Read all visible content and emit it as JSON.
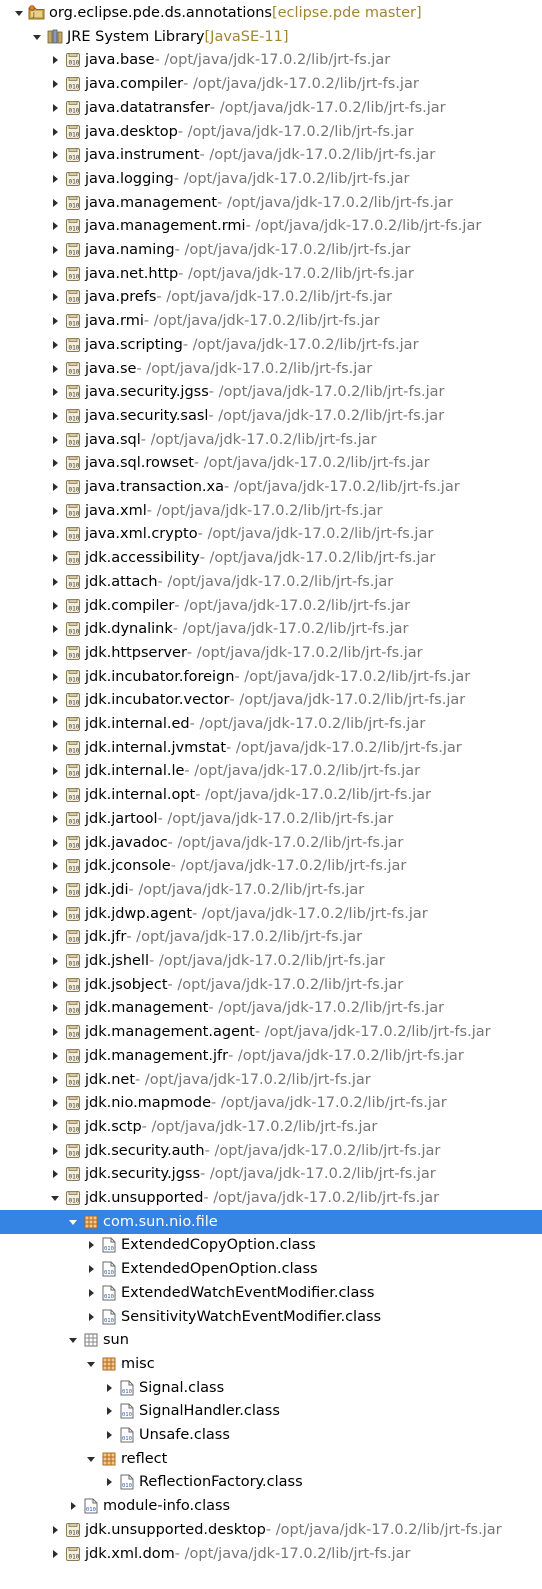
{
  "colors": {
    "selection": "#3584e4",
    "decoration": "#777777",
    "vcs_decoration": "#a08630",
    "jar_icon": "#8a7a55",
    "package_icon": "#b3651e",
    "class_icon": "#2c5b9e"
  },
  "tree": [
    {
      "label": "org.eclipse.pde.ds.annotations",
      "decoration": " [eclipse.pde master]",
      "level": 0,
      "icon": "project-icon",
      "state": "expanded"
    },
    {
      "label": "JRE System Library",
      "decoration": " [JavaSE-11]",
      "level": 1,
      "icon": "library-icon",
      "state": "expanded"
    },
    {
      "label": "java.base",
      "decoration": " - /opt/java/jdk-17.0.2/lib/jrt-fs.jar",
      "level": 2,
      "icon": "jar-icon",
      "state": "collapsed"
    },
    {
      "label": "java.compiler",
      "decoration": " - /opt/java/jdk-17.0.2/lib/jrt-fs.jar",
      "level": 2,
      "icon": "jar-icon",
      "state": "collapsed"
    },
    {
      "label": "java.datatransfer",
      "decoration": " - /opt/java/jdk-17.0.2/lib/jrt-fs.jar",
      "level": 2,
      "icon": "jar-icon",
      "state": "collapsed"
    },
    {
      "label": "java.desktop",
      "decoration": " - /opt/java/jdk-17.0.2/lib/jrt-fs.jar",
      "level": 2,
      "icon": "jar-icon",
      "state": "collapsed"
    },
    {
      "label": "java.instrument",
      "decoration": " - /opt/java/jdk-17.0.2/lib/jrt-fs.jar",
      "level": 2,
      "icon": "jar-icon",
      "state": "collapsed"
    },
    {
      "label": "java.logging",
      "decoration": " - /opt/java/jdk-17.0.2/lib/jrt-fs.jar",
      "level": 2,
      "icon": "jar-icon",
      "state": "collapsed"
    },
    {
      "label": "java.management",
      "decoration": " - /opt/java/jdk-17.0.2/lib/jrt-fs.jar",
      "level": 2,
      "icon": "jar-icon",
      "state": "collapsed"
    },
    {
      "label": "java.management.rmi",
      "decoration": " - /opt/java/jdk-17.0.2/lib/jrt-fs.jar",
      "level": 2,
      "icon": "jar-icon",
      "state": "collapsed"
    },
    {
      "label": "java.naming",
      "decoration": " - /opt/java/jdk-17.0.2/lib/jrt-fs.jar",
      "level": 2,
      "icon": "jar-icon",
      "state": "collapsed"
    },
    {
      "label": "java.net.http",
      "decoration": " - /opt/java/jdk-17.0.2/lib/jrt-fs.jar",
      "level": 2,
      "icon": "jar-icon",
      "state": "collapsed"
    },
    {
      "label": "java.prefs",
      "decoration": " - /opt/java/jdk-17.0.2/lib/jrt-fs.jar",
      "level": 2,
      "icon": "jar-icon",
      "state": "collapsed"
    },
    {
      "label": "java.rmi",
      "decoration": " - /opt/java/jdk-17.0.2/lib/jrt-fs.jar",
      "level": 2,
      "icon": "jar-icon",
      "state": "collapsed"
    },
    {
      "label": "java.scripting",
      "decoration": " - /opt/java/jdk-17.0.2/lib/jrt-fs.jar",
      "level": 2,
      "icon": "jar-icon",
      "state": "collapsed"
    },
    {
      "label": "java.se",
      "decoration": " - /opt/java/jdk-17.0.2/lib/jrt-fs.jar",
      "level": 2,
      "icon": "jar-icon",
      "state": "collapsed"
    },
    {
      "label": "java.security.jgss",
      "decoration": " - /opt/java/jdk-17.0.2/lib/jrt-fs.jar",
      "level": 2,
      "icon": "jar-icon",
      "state": "collapsed"
    },
    {
      "label": "java.security.sasl",
      "decoration": " - /opt/java/jdk-17.0.2/lib/jrt-fs.jar",
      "level": 2,
      "icon": "jar-icon",
      "state": "collapsed"
    },
    {
      "label": "java.sql",
      "decoration": " - /opt/java/jdk-17.0.2/lib/jrt-fs.jar",
      "level": 2,
      "icon": "jar-icon",
      "state": "collapsed"
    },
    {
      "label": "java.sql.rowset",
      "decoration": " - /opt/java/jdk-17.0.2/lib/jrt-fs.jar",
      "level": 2,
      "icon": "jar-icon",
      "state": "collapsed"
    },
    {
      "label": "java.transaction.xa",
      "decoration": " - /opt/java/jdk-17.0.2/lib/jrt-fs.jar",
      "level": 2,
      "icon": "jar-icon",
      "state": "collapsed"
    },
    {
      "label": "java.xml",
      "decoration": " - /opt/java/jdk-17.0.2/lib/jrt-fs.jar",
      "level": 2,
      "icon": "jar-icon",
      "state": "collapsed"
    },
    {
      "label": "java.xml.crypto",
      "decoration": " - /opt/java/jdk-17.0.2/lib/jrt-fs.jar",
      "level": 2,
      "icon": "jar-icon",
      "state": "collapsed"
    },
    {
      "label": "jdk.accessibility",
      "decoration": " - /opt/java/jdk-17.0.2/lib/jrt-fs.jar",
      "level": 2,
      "icon": "jar-icon",
      "state": "collapsed"
    },
    {
      "label": "jdk.attach",
      "decoration": " - /opt/java/jdk-17.0.2/lib/jrt-fs.jar",
      "level": 2,
      "icon": "jar-icon",
      "state": "collapsed"
    },
    {
      "label": "jdk.compiler",
      "decoration": " - /opt/java/jdk-17.0.2/lib/jrt-fs.jar",
      "level": 2,
      "icon": "jar-icon",
      "state": "collapsed"
    },
    {
      "label": "jdk.dynalink",
      "decoration": " - /opt/java/jdk-17.0.2/lib/jrt-fs.jar",
      "level": 2,
      "icon": "jar-icon",
      "state": "collapsed"
    },
    {
      "label": "jdk.httpserver",
      "decoration": " - /opt/java/jdk-17.0.2/lib/jrt-fs.jar",
      "level": 2,
      "icon": "jar-icon",
      "state": "collapsed"
    },
    {
      "label": "jdk.incubator.foreign",
      "decoration": " - /opt/java/jdk-17.0.2/lib/jrt-fs.jar",
      "level": 2,
      "icon": "jar-icon",
      "state": "collapsed"
    },
    {
      "label": "jdk.incubator.vector",
      "decoration": " - /opt/java/jdk-17.0.2/lib/jrt-fs.jar",
      "level": 2,
      "icon": "jar-icon",
      "state": "collapsed"
    },
    {
      "label": "jdk.internal.ed",
      "decoration": " - /opt/java/jdk-17.0.2/lib/jrt-fs.jar",
      "level": 2,
      "icon": "jar-icon",
      "state": "collapsed"
    },
    {
      "label": "jdk.internal.jvmstat",
      "decoration": " - /opt/java/jdk-17.0.2/lib/jrt-fs.jar",
      "level": 2,
      "icon": "jar-icon",
      "state": "collapsed"
    },
    {
      "label": "jdk.internal.le",
      "decoration": " - /opt/java/jdk-17.0.2/lib/jrt-fs.jar",
      "level": 2,
      "icon": "jar-icon",
      "state": "collapsed"
    },
    {
      "label": "jdk.internal.opt",
      "decoration": " - /opt/java/jdk-17.0.2/lib/jrt-fs.jar",
      "level": 2,
      "icon": "jar-icon",
      "state": "collapsed"
    },
    {
      "label": "jdk.jartool",
      "decoration": " - /opt/java/jdk-17.0.2/lib/jrt-fs.jar",
      "level": 2,
      "icon": "jar-icon",
      "state": "collapsed"
    },
    {
      "label": "jdk.javadoc",
      "decoration": " - /opt/java/jdk-17.0.2/lib/jrt-fs.jar",
      "level": 2,
      "icon": "jar-icon",
      "state": "collapsed"
    },
    {
      "label": "jdk.jconsole",
      "decoration": " - /opt/java/jdk-17.0.2/lib/jrt-fs.jar",
      "level": 2,
      "icon": "jar-icon",
      "state": "collapsed"
    },
    {
      "label": "jdk.jdi",
      "decoration": " - /opt/java/jdk-17.0.2/lib/jrt-fs.jar",
      "level": 2,
      "icon": "jar-icon",
      "state": "collapsed"
    },
    {
      "label": "jdk.jdwp.agent",
      "decoration": " - /opt/java/jdk-17.0.2/lib/jrt-fs.jar",
      "level": 2,
      "icon": "jar-icon",
      "state": "collapsed"
    },
    {
      "label": "jdk.jfr",
      "decoration": " - /opt/java/jdk-17.0.2/lib/jrt-fs.jar",
      "level": 2,
      "icon": "jar-icon",
      "state": "collapsed"
    },
    {
      "label": "jdk.jshell",
      "decoration": " - /opt/java/jdk-17.0.2/lib/jrt-fs.jar",
      "level": 2,
      "icon": "jar-icon",
      "state": "collapsed"
    },
    {
      "label": "jdk.jsobject",
      "decoration": " - /opt/java/jdk-17.0.2/lib/jrt-fs.jar",
      "level": 2,
      "icon": "jar-icon",
      "state": "collapsed"
    },
    {
      "label": "jdk.management",
      "decoration": " - /opt/java/jdk-17.0.2/lib/jrt-fs.jar",
      "level": 2,
      "icon": "jar-icon",
      "state": "collapsed"
    },
    {
      "label": "jdk.management.agent",
      "decoration": " - /opt/java/jdk-17.0.2/lib/jrt-fs.jar",
      "level": 2,
      "icon": "jar-icon",
      "state": "collapsed"
    },
    {
      "label": "jdk.management.jfr",
      "decoration": " - /opt/java/jdk-17.0.2/lib/jrt-fs.jar",
      "level": 2,
      "icon": "jar-icon",
      "state": "collapsed"
    },
    {
      "label": "jdk.net",
      "decoration": " - /opt/java/jdk-17.0.2/lib/jrt-fs.jar",
      "level": 2,
      "icon": "jar-icon",
      "state": "collapsed"
    },
    {
      "label": "jdk.nio.mapmode",
      "decoration": " - /opt/java/jdk-17.0.2/lib/jrt-fs.jar",
      "level": 2,
      "icon": "jar-icon",
      "state": "collapsed"
    },
    {
      "label": "jdk.sctp",
      "decoration": " - /opt/java/jdk-17.0.2/lib/jrt-fs.jar",
      "level": 2,
      "icon": "jar-icon",
      "state": "collapsed"
    },
    {
      "label": "jdk.security.auth",
      "decoration": " - /opt/java/jdk-17.0.2/lib/jrt-fs.jar",
      "level": 2,
      "icon": "jar-icon",
      "state": "collapsed"
    },
    {
      "label": "jdk.security.jgss",
      "decoration": " - /opt/java/jdk-17.0.2/lib/jrt-fs.jar",
      "level": 2,
      "icon": "jar-icon",
      "state": "collapsed"
    },
    {
      "label": "jdk.unsupported",
      "decoration": " - /opt/java/jdk-17.0.2/lib/jrt-fs.jar",
      "level": 2,
      "icon": "jar-icon",
      "state": "expanded"
    },
    {
      "label": "com.sun.nio.file",
      "decoration": "",
      "level": 3,
      "icon": "package-icon",
      "state": "expanded",
      "selected": true
    },
    {
      "label": "ExtendedCopyOption.class",
      "decoration": "",
      "level": 4,
      "icon": "class-file-icon",
      "state": "collapsed"
    },
    {
      "label": "ExtendedOpenOption.class",
      "decoration": "",
      "level": 4,
      "icon": "class-file-icon",
      "state": "collapsed"
    },
    {
      "label": "ExtendedWatchEventModifier.class",
      "decoration": "",
      "level": 4,
      "icon": "class-file-icon",
      "state": "collapsed"
    },
    {
      "label": "SensitivityWatchEventModifier.class",
      "decoration": "",
      "level": 4,
      "icon": "class-file-icon",
      "state": "collapsed"
    },
    {
      "label": "sun",
      "decoration": "",
      "level": 3,
      "icon": "empty-package-icon",
      "state": "expanded"
    },
    {
      "label": "misc",
      "decoration": "",
      "level": 4,
      "icon": "package-icon",
      "state": "expanded"
    },
    {
      "label": "Signal.class",
      "decoration": "",
      "level": 5,
      "icon": "class-file-icon",
      "state": "collapsed"
    },
    {
      "label": "SignalHandler.class",
      "decoration": "",
      "level": 5,
      "icon": "class-file-icon",
      "state": "collapsed"
    },
    {
      "label": "Unsafe.class",
      "decoration": "",
      "level": 5,
      "icon": "class-file-icon",
      "state": "collapsed"
    },
    {
      "label": "reflect",
      "decoration": "",
      "level": 4,
      "icon": "package-icon",
      "state": "expanded"
    },
    {
      "label": "ReflectionFactory.class",
      "decoration": "",
      "level": 5,
      "icon": "class-file-icon",
      "state": "collapsed"
    },
    {
      "label": "module-info.class",
      "decoration": "",
      "level": 3,
      "icon": "class-file-icon",
      "state": "collapsed"
    },
    {
      "label": "jdk.unsupported.desktop",
      "decoration": " - /opt/java/jdk-17.0.2/lib/jrt-fs.jar",
      "level": 2,
      "icon": "jar-icon",
      "state": "collapsed"
    },
    {
      "label": "jdk.xml.dom",
      "decoration": " - /opt/java/jdk-17.0.2/lib/jrt-fs.jar",
      "level": 2,
      "icon": "jar-icon",
      "state": "collapsed"
    }
  ]
}
